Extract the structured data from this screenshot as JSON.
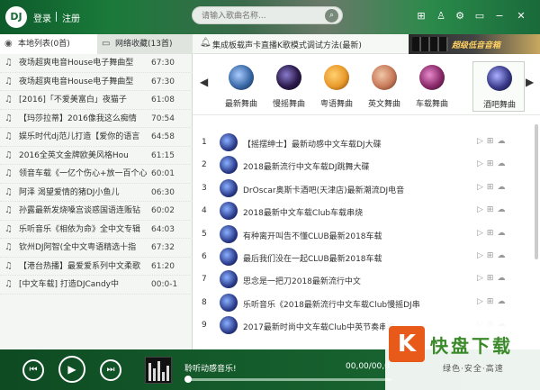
{
  "header": {
    "logo": "DJ",
    "login": "登录",
    "register": "注册",
    "search_placeholder": "请输入歌曲名称...",
    "icons": [
      "grid-icon",
      "shirt-icon",
      "gear-icon",
      "minimize-icon",
      "maximize-icon",
      "close-icon"
    ]
  },
  "left_tabs": {
    "local": "本地列表(0首)",
    "network": "网络收藏(13首)"
  },
  "songs": [
    {
      "title": "夜场超爽电音House电子舞曲型",
      "duration": "67:30"
    },
    {
      "title": "夜场超爽电音House电子舞曲型",
      "duration": "67:30"
    },
    {
      "title": "[2016]「不爱美富白」夜猫子",
      "duration": "61:08"
    },
    {
      "title": "【玛莎拉蒂】2016像我这么痴情",
      "duration": "70:54"
    },
    {
      "title": "娱乐时代dj范儿打造【爱你的语言",
      "duration": "64:58"
    },
    {
      "title": "2016全英文金牌欧美风格Hou",
      "duration": "61:15"
    },
    {
      "title": "领音车载《一亿个伤心+放一百个心",
      "duration": "60:01"
    },
    {
      "title": "阿泽  渴望爱情的猪DJ小鱼儿",
      "duration": "06:30"
    },
    {
      "title": "孙露最新发烧嗓宫谈惑国语连贩钻",
      "duration": "60:02"
    },
    {
      "title": "乐听音乐《相依为命》全中文专辑",
      "duration": "64:03"
    },
    {
      "title": "钦州DJ阿智(全中文粤语精选十指",
      "duration": "67:32"
    },
    {
      "title": "【港台热播】最爱爱系列中文柔歌",
      "duration": "61:20"
    },
    {
      "title": "[中文车载] 打造DJCandy中",
      "duration": "00:0-1"
    }
  ],
  "notice": {
    "text": "集成板载声卡直播K歌模式调试方法(最新)",
    "banner": "超级低音音箱"
  },
  "categories": [
    {
      "label": "最新舞曲",
      "color": "#3a6aa8"
    },
    {
      "label": "慢摇舞曲",
      "color": "#2a1a4a"
    },
    {
      "label": "粤语舞曲",
      "color": "#e89a2a"
    },
    {
      "label": "英文舞曲",
      "color": "#c87a5a"
    },
    {
      "label": "车载舞曲",
      "color": "#8a2a6a"
    },
    {
      "label": "酒吧舞曲",
      "color": "#3a3a8a"
    }
  ],
  "tracks": [
    {
      "num": "1",
      "title": "【摇摆绅士】最新动感中文车载DJ大碟"
    },
    {
      "num": "2",
      "title": "2018最新流行中文车载DJ跳舞大碟"
    },
    {
      "num": "3",
      "title": "DrOscar奥斯卡酒吧(天津店)最新潮流DJ电音"
    },
    {
      "num": "4",
      "title": "2018最新中文车载Club车载串烧"
    },
    {
      "num": "5",
      "title": "有种离开叫告不懂CLUB最新2018车载"
    },
    {
      "num": "6",
      "title": "最后我们没在一起CLUB最新2018车载"
    },
    {
      "num": "7",
      "title": "思念是一把刀2018最新流行中文"
    },
    {
      "num": "8",
      "title": "乐听音乐《2018最新流行中文车载Club慢摇DJ串"
    },
    {
      "num": "9",
      "title": "2017最新时尚中文车载Club中英节奏串烧"
    }
  ],
  "player": {
    "now_playing": "聆听动感音乐!",
    "time": "00,00/00,0"
  },
  "watermark": {
    "badge": "K",
    "title": "快盘下载",
    "slogan": "绿色·安全·高速"
  }
}
